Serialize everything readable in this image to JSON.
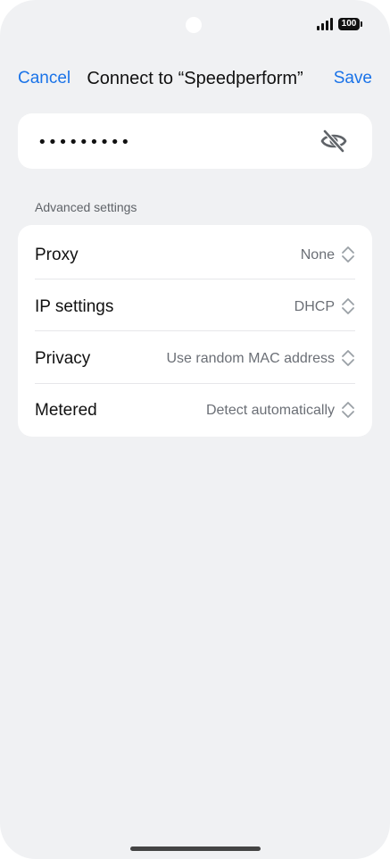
{
  "status_bar": {
    "battery_level": "100"
  },
  "header": {
    "cancel_label": "Cancel",
    "title": "Connect to “Speedperform”",
    "save_label": "Save"
  },
  "password": {
    "value": "•••••••••",
    "visibility_icon": "eye-off-icon"
  },
  "advanced": {
    "section_label": "Advanced settings",
    "rows": [
      {
        "label": "Proxy",
        "value": "None"
      },
      {
        "label": "IP settings",
        "value": "DHCP"
      },
      {
        "label": "Privacy",
        "value": "Use random MAC address"
      },
      {
        "label": "Metered",
        "value": "Detect automatically"
      }
    ]
  },
  "colors": {
    "accent": "#1a73e8",
    "background": "#f0f1f3",
    "card": "#ffffff"
  }
}
